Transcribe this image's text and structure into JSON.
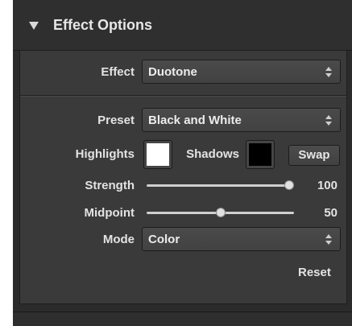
{
  "panel": {
    "title": "Effect Options"
  },
  "effect": {
    "label": "Effect",
    "value": "Duotone"
  },
  "preset": {
    "label": "Preset",
    "value": "Black and White"
  },
  "colors": {
    "highlights_label": "Highlights",
    "highlights_color": "#ffffff",
    "shadows_label": "Shadows",
    "shadows_color": "#000000",
    "swap_label": "Swap"
  },
  "strength": {
    "label": "Strength",
    "value": "100",
    "fraction": 1.0
  },
  "midpoint": {
    "label": "Midpoint",
    "value": "50",
    "fraction": 0.5
  },
  "mode": {
    "label": "Mode",
    "value": "Color"
  },
  "reset_label": "Reset"
}
